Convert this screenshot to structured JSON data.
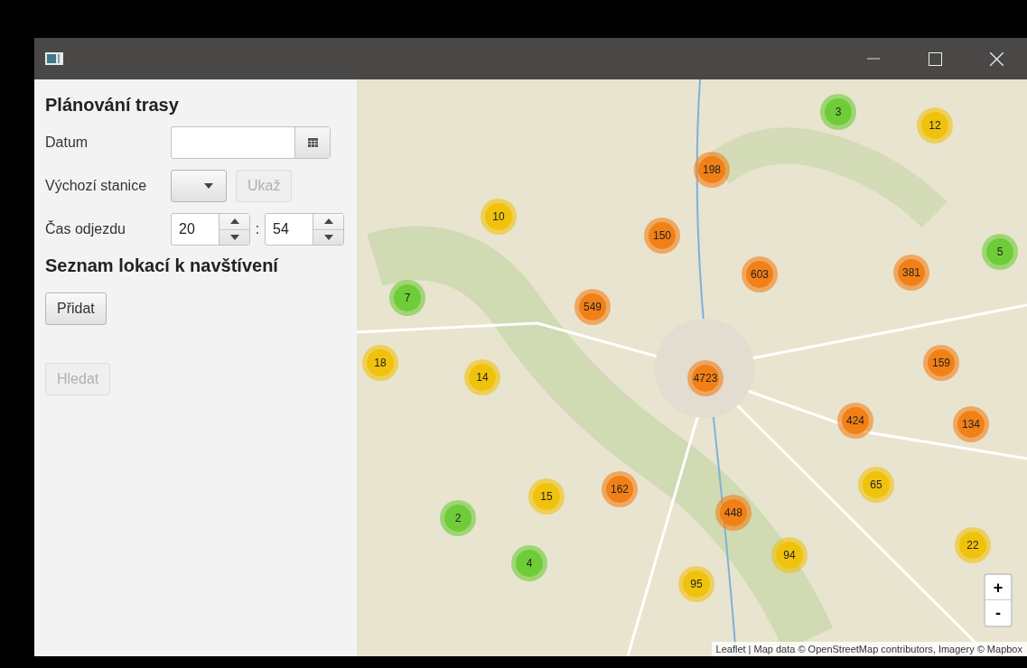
{
  "panel": {
    "title": "Plánování trasy",
    "date": {
      "label": "Datum"
    },
    "station": {
      "label": "Výchozí stanice",
      "show_button": {
        "label": "Ukaž",
        "disabled": true
      }
    },
    "departure": {
      "label": "Čas odjezdu",
      "hour": "20",
      "separator": ":",
      "minute": "54"
    },
    "locations_title": "Seznam lokací k navštívení",
    "add_button": {
      "label": "Přidat",
      "disabled": false
    },
    "search_button": {
      "label": "Hledat",
      "disabled": true
    }
  },
  "map": {
    "clusters": [
      {
        "count": "3",
        "color": "#6ecc39"
      },
      {
        "count": "12",
        "color": "#f0c20c"
      },
      {
        "count": "198",
        "color": "#f18017"
      },
      {
        "count": "10",
        "color": "#f0c20c"
      },
      {
        "count": "150",
        "color": "#f18017"
      },
      {
        "count": "5",
        "color": "#6ecc39"
      },
      {
        "count": "603",
        "color": "#f18017"
      },
      {
        "count": "381",
        "color": "#f18017"
      },
      {
        "count": "7",
        "color": "#6ecc39"
      },
      {
        "count": "549",
        "color": "#f18017"
      },
      {
        "count": "18",
        "color": "#f0c20c"
      },
      {
        "count": "14",
        "color": "#f0c20c"
      },
      {
        "count": "159",
        "color": "#f18017"
      },
      {
        "count": "4723",
        "color": "#f18017"
      },
      {
        "count": "424",
        "color": "#f18017"
      },
      {
        "count": "134",
        "color": "#f18017"
      },
      {
        "count": "65",
        "color": "#f0c20c"
      },
      {
        "count": "15",
        "color": "#f0c20c"
      },
      {
        "count": "162",
        "color": "#f18017"
      },
      {
        "count": "2",
        "color": "#6ecc39"
      },
      {
        "count": "448",
        "color": "#f18017"
      },
      {
        "count": "94",
        "color": "#f0c20c"
      },
      {
        "count": "22",
        "color": "#f0c20c"
      },
      {
        "count": "4",
        "color": "#6ecc39"
      },
      {
        "count": "95",
        "color": "#f0c20c"
      }
    ],
    "zoom_in": "+",
    "zoom_out": "-",
    "attribution": "Leaflet | Map data © OpenStreetMap contributors, Imagery © Mapbox"
  }
}
